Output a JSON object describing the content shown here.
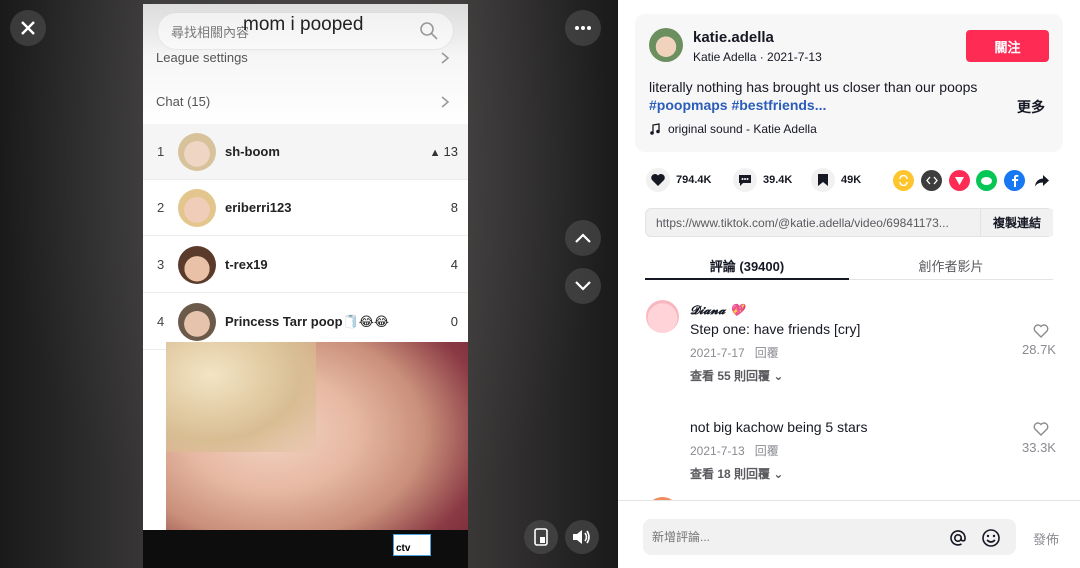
{
  "video": {
    "caption": "mom i pooped",
    "search_placeholder": "尋找相關內容",
    "settings": [
      {
        "label": "League settings"
      },
      {
        "label": "Chat (15)"
      }
    ],
    "leaderboard": [
      {
        "rank": "1",
        "name": "sh-boom",
        "score": "13",
        "badge": "poop"
      },
      {
        "rank": "2",
        "name": "eriberri123",
        "score": "8"
      },
      {
        "rank": "3",
        "name": "t-rex19",
        "score": "4"
      },
      {
        "rank": "4",
        "name": "Princess Tarr poop🧻😂😂",
        "score": "0"
      }
    ],
    "ad_text": "ctv",
    "controls": {
      "close": "close-icon",
      "more": "more-icon",
      "prev": "chevron-up-icon",
      "next": "chevron-down-icon",
      "pip": "pip-icon",
      "volume": "volume-icon"
    }
  },
  "author": {
    "username": "katie.adella",
    "meta": "Katie Adella · 2021-7-13",
    "follow_label": "關注"
  },
  "description": {
    "text": "literally nothing has brought us closer than our poops",
    "hashtags": "#poopmaps #bestfriends...",
    "more_label": "更多",
    "sound": "original sound - Katie Adella"
  },
  "stats": {
    "likes": "794.4K",
    "comments": "39.4K",
    "saves": "49K"
  },
  "share_icons": [
    "repost-icon",
    "embed-icon",
    "send-icon",
    "line-icon",
    "facebook-icon",
    "share-arrow-icon"
  ],
  "link": {
    "url": "https://www.tiktok.com/@katie.adella/video/69841173...",
    "copy_label": "複製連結"
  },
  "tabs": {
    "comments": "評論 (39400)",
    "creator": "創作者影片"
  },
  "comments": [
    {
      "name": "𝓓𝓲𝓪𝓷𝓪 💖",
      "text": "Step one: have friends [cry]",
      "date": "2021-7-17",
      "reply_label": "回覆",
      "view_replies": "查看 55 則回覆",
      "likes": "28.7K"
    },
    {
      "name": "",
      "text": "not big kachow being 5 stars",
      "date": "2021-7-13",
      "reply_label": "回覆",
      "view_replies": "查看 18 則回覆",
      "likes": "33.3K"
    }
  ],
  "comment_bar": {
    "placeholder": "新增評論...",
    "post_label": "發佈"
  },
  "colors": {
    "follow": "#fe2c55",
    "hashtag": "#2b5db9"
  }
}
